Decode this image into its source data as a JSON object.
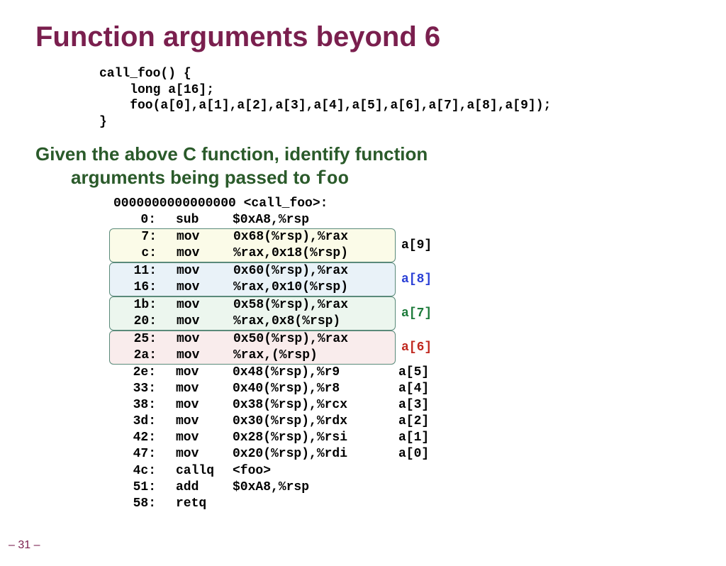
{
  "title": "Function arguments beyond 6",
  "c_code": "call_foo() {\n    long a[16];\n    foo(a[0],a[1],a[2],a[3],a[4],a[5],a[6],a[7],a[8],a[9]);\n}",
  "prompt_line1": "Given the above C function, identify function",
  "prompt_line2": "arguments being passed to ",
  "prompt_func": "foo",
  "asm_header": "0000000000000000 <call_foo>:",
  "rows": [
    {
      "addr": "0:",
      "op": "sub",
      "args": "$0xA8,%rsp",
      "anno": "",
      "group": "plain"
    },
    {
      "addr": "7:",
      "op": "mov",
      "args": "0x68(%rsp),%rax",
      "anno": "a[9]",
      "group": "box-yellow",
      "anno_cls": "anno-black"
    },
    {
      "addr": "c:",
      "op": "mov",
      "args": "%rax,0x18(%rsp)",
      "anno": "",
      "group": "box-yellow"
    },
    {
      "addr": "11:",
      "op": "mov",
      "args": "0x60(%rsp),%rax",
      "anno": "a[8]",
      "group": "box-blue",
      "anno_cls": "anno-blue"
    },
    {
      "addr": "16:",
      "op": "mov",
      "args": "%rax,0x10(%rsp)",
      "anno": "",
      "group": "box-blue"
    },
    {
      "addr": "1b:",
      "op": "mov",
      "args": "0x58(%rsp),%rax",
      "anno": "a[7]",
      "group": "box-green",
      "anno_cls": "anno-green"
    },
    {
      "addr": "20:",
      "op": "mov",
      "args": "%rax,0x8(%rsp)",
      "anno": "",
      "group": "box-green"
    },
    {
      "addr": "25:",
      "op": "mov",
      "args": "0x50(%rsp),%rax",
      "anno": "a[6]",
      "group": "box-pink",
      "anno_cls": "anno-red"
    },
    {
      "addr": "2a:",
      "op": "mov",
      "args": "%rax,(%rsp)",
      "anno": "",
      "group": "box-pink"
    },
    {
      "addr": "2e:",
      "op": "mov",
      "args": "0x48(%rsp),%r9",
      "anno": "a[5]",
      "group": "plain",
      "anno_cls": "anno-black"
    },
    {
      "addr": "33:",
      "op": "mov",
      "args": "0x40(%rsp),%r8",
      "anno": "a[4]",
      "group": "plain",
      "anno_cls": "anno-black"
    },
    {
      "addr": "38:",
      "op": "mov",
      "args": "0x38(%rsp),%rcx",
      "anno": "a[3]",
      "group": "plain",
      "anno_cls": "anno-black"
    },
    {
      "addr": "3d:",
      "op": "mov",
      "args": "0x30(%rsp),%rdx",
      "anno": "a[2]",
      "group": "plain",
      "anno_cls": "anno-black"
    },
    {
      "addr": "42:",
      "op": "mov",
      "args": "0x28(%rsp),%rsi",
      "anno": "a[1]",
      "group": "plain",
      "anno_cls": "anno-black"
    },
    {
      "addr": "47:",
      "op": "mov",
      "args": "0x20(%rsp),%rdi",
      "anno": "a[0]",
      "group": "plain",
      "anno_cls": "anno-black"
    },
    {
      "addr": "4c:",
      "op": "callq",
      "args": "<foo>",
      "anno": "",
      "group": "plain"
    },
    {
      "addr": "51:",
      "op": "add",
      "args": "$0xA8,%rsp",
      "anno": "",
      "group": "plain"
    },
    {
      "addr": "58:",
      "op": "retq",
      "args": "",
      "anno": "",
      "group": "plain"
    }
  ],
  "slide_num": "– 31 –"
}
